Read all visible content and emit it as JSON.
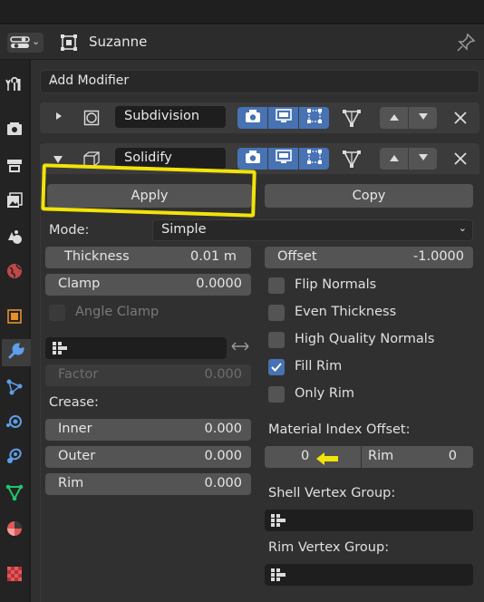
{
  "header": {
    "object_name": "Suzanne"
  },
  "add_modifier_label": "Add Modifier",
  "modifiers": [
    {
      "name": "Subdivision",
      "expanded": false
    },
    {
      "name": "Solidify",
      "expanded": true
    }
  ],
  "solidify": {
    "apply_label": "Apply",
    "copy_label": "Copy",
    "mode_label": "Mode:",
    "mode_value": "Simple",
    "thickness": {
      "label": "Thickness",
      "value": "0.01 m"
    },
    "offset": {
      "label": "Offset",
      "value": "-1.0000"
    },
    "clamp": {
      "label": "Clamp",
      "value": "0.0000"
    },
    "angle_clamp_label": "Angle Clamp",
    "factor": {
      "label": "Factor",
      "value": "0.000"
    },
    "crease_label": "Crease:",
    "inner": {
      "label": "Inner",
      "value": "0.000"
    },
    "outer": {
      "label": "Outer",
      "value": "0.000"
    },
    "rim": {
      "label": "Rim",
      "value": "0.000"
    },
    "checkboxes": [
      {
        "label": "Flip Normals",
        "checked": false
      },
      {
        "label": "Even Thickness",
        "checked": false
      },
      {
        "label": "High Quality Normals",
        "checked": false
      },
      {
        "label": "Fill Rim",
        "checked": true
      },
      {
        "label": "Only Rim",
        "checked": false
      }
    ],
    "material_index_offset_label": "Material Index Offset:",
    "material_offset_value": "0",
    "material_rim_label": "Rim",
    "material_rim_value": "0",
    "shell_vertex_group_label": "Shell Vertex Group:",
    "rim_vertex_group_label": "Rim Vertex Group:"
  },
  "colors": {
    "annotation": "#f2e30a",
    "accent_blue": "#4772b3"
  },
  "icons": [
    "editor-type-icon",
    "object-data-icon",
    "pin-icon",
    "tool-icon",
    "render-icon",
    "output-icon",
    "view-layer-icon",
    "scene-icon",
    "world-icon",
    "object-icon",
    "modifier-wrench-icon",
    "particles-icon",
    "physics-icon",
    "constraints-icon",
    "object-data-mesh-icon",
    "material-icon",
    "texture-icon"
  ]
}
